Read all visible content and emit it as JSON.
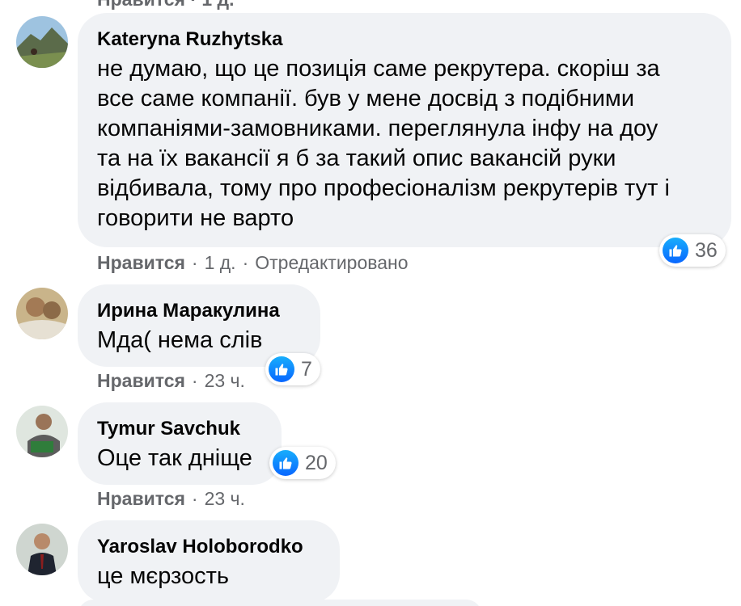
{
  "top_fragment": "Нравится · 1 д.",
  "like_icon": "thumbs-up-icon",
  "accent_color": "#0866ff",
  "comments": [
    {
      "author": "Kateryna Ruzhytska",
      "lines": [
        "не думаю, що це позиція саме рекрутера. скоріш за",
        "все саме компанії. був у мене досвід з подібними",
        "компаніями-замовниками. переглянула інфу на доу",
        "та на їх вакансії я б за такий опис вакансій руки",
        "відбивала, тому про професіоналізм рекрутерів тут і",
        "говорити не варто"
      ],
      "reactions": "36",
      "like_label": "Нравится",
      "time": "1 д.",
      "edited": "Отредактировано"
    },
    {
      "author": "Ирина Маракулина",
      "text": "Мда( нема слів",
      "reactions": "7",
      "like_label": "Нравится",
      "time": "23 ч."
    },
    {
      "author": "Tymur Savchuk",
      "text": "Оце так дніще",
      "reactions": "20",
      "like_label": "Нравится",
      "time": "23 ч."
    },
    {
      "author": "Yaroslav Holoborodko",
      "text": "це мєрзость"
    }
  ]
}
